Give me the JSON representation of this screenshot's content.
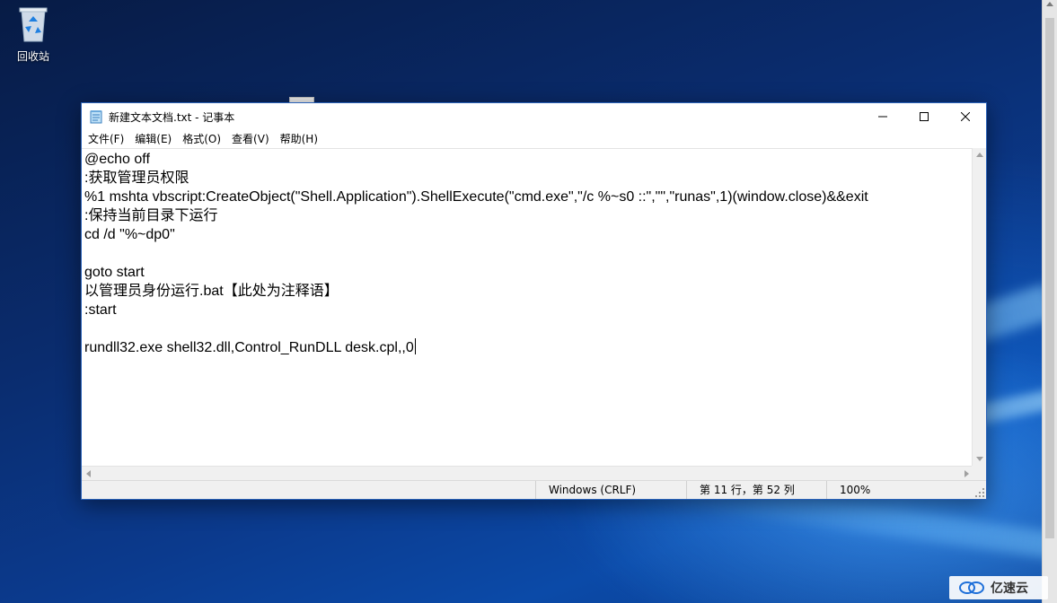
{
  "desktop": {
    "recycle_bin_label": "回收站",
    "icon_names": {
      "recycle_bin": "recycle-bin-icon",
      "watermark": "yisu-cloud-logo-icon"
    },
    "watermark_text": "亿速云"
  },
  "window": {
    "title": "新建文本文档.txt - 记事本",
    "icon": "notepad-icon",
    "caption": {
      "minimize": "minimize-icon",
      "maximize": "maximize-icon",
      "close": "close-icon"
    },
    "accent": "#2a62b8"
  },
  "menu": {
    "items": [
      {
        "label": "文件(F)"
      },
      {
        "label": "编辑(E)"
      },
      {
        "label": "格式(O)"
      },
      {
        "label": "查看(V)"
      },
      {
        "label": "帮助(H)"
      }
    ]
  },
  "editor": {
    "lines": [
      "@echo off",
      ":获取管理员权限",
      "%1 mshta vbscript:CreateObject(\"Shell.Application\").ShellExecute(\"cmd.exe\",\"/c %~s0 ::\",\"\",\"runas\",1)(window.close)&&exit",
      ":保持当前目录下运行",
      "cd /d \"%~dp0\"",
      "",
      "goto start",
      "以管理员身份运行.bat【此处为注释语】",
      ":start",
      "",
      "rundll32.exe shell32.dll,Control_RunDLL desk.cpl,,0"
    ]
  },
  "status": {
    "encoding": "Windows (CRLF)",
    "position": "第 11 行，第 52 列",
    "zoom": "100%"
  }
}
